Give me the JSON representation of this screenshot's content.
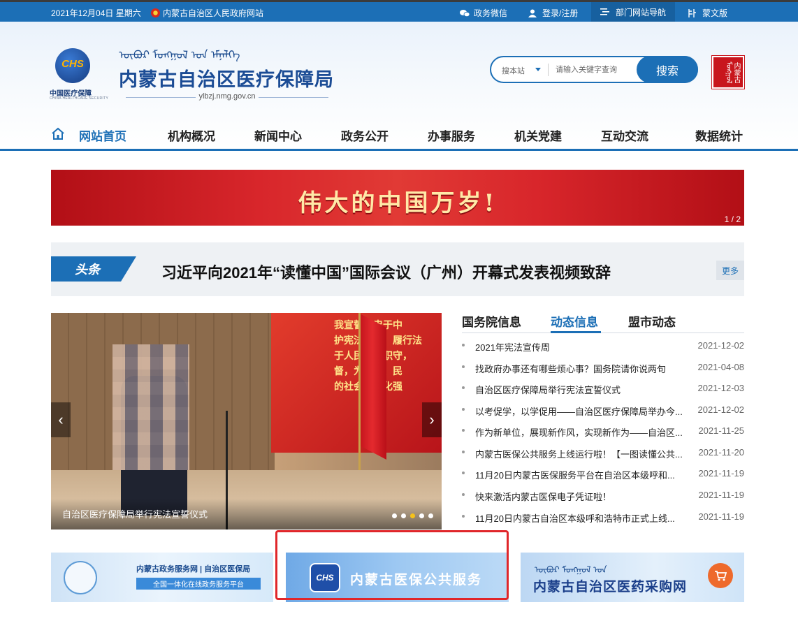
{
  "topbar": {
    "date": "2021年12月04日 星期六",
    "gov_link": "内蒙古自治区人民政府网站",
    "wechat": "政务微信",
    "login": "登录/注册",
    "dept_nav": "部门网站导航",
    "mongolian": "蒙文版"
  },
  "header": {
    "logo_text": "CHS",
    "logo_cn": "中国医疗保障",
    "logo_en": "CHINA HEALTHCARE SECURITY",
    "mongolian_title": "ᠥᠪᠦᠷ ᠮᠣᠩᠭᠣᠯ ᠤᠨ ᠡᠮᠨᠡᠯᠭᠡ",
    "title": "内蒙古自治区医疗保障局",
    "domain": "ylbzj.nmg.gov.cn",
    "seal_text": "内蒙古ᠮᠣᠩᠭᠣᠯ"
  },
  "search": {
    "scope": "搜本站",
    "placeholder": "请输入关键字查询",
    "button": "搜索"
  },
  "nav": {
    "items": [
      "网站首页",
      "机构概况",
      "新闻中心",
      "政务公开",
      "办事服务",
      "机关党建",
      "互动交流",
      "数据统计"
    ]
  },
  "banner": {
    "text": "伟大的中国万岁!",
    "page": "1 / 2"
  },
  "headline": {
    "tag": "头条",
    "title": "习近平向2021年“读懂中国”国际会议（广州）开幕式发表视频致辞",
    "more": "更多"
  },
  "carousel": {
    "caption": "自治区医疗保障局举行宪法宣誓仪式",
    "oath_lines": [
      "我宣誓：忠于中",
      "护宪法权威，履行法",
      "于人民，尽职守，",
      "督，为富强、民",
      "的社会现代化强"
    ],
    "prev": "‹",
    "next": "›",
    "active_dot": 3
  },
  "news": {
    "tabs": [
      "国务院信息",
      "动态信息",
      "盟市动态"
    ],
    "active_tab": 1,
    "items": [
      {
        "title": "2021年宪法宣传周",
        "date": "2021-12-02"
      },
      {
        "title": "找政府办事还有哪些烦心事？国务院请你说两句",
        "date": "2021-04-08"
      },
      {
        "title": "自治区医疗保障局举行宪法宣誓仪式",
        "date": "2021-12-03"
      },
      {
        "title": "以考促学，以学促用——自治区医疗保障局举办今...",
        "date": "2021-12-02"
      },
      {
        "title": "作为新单位，展现新作风，实现新作为——自治区...",
        "date": "2021-11-25"
      },
      {
        "title": "内蒙古医保公共服务上线运行啦！【一图读懂公共...",
        "date": "2021-11-20"
      },
      {
        "title": "11月20日内蒙古医保服务平台在自治区本级呼和...",
        "date": "2021-11-19"
      },
      {
        "title": "快来激活内蒙古医保电子凭证啦！",
        "date": "2021-11-19"
      },
      {
        "title": "11月20日内蒙古自治区本级呼和浩特市正式上线...",
        "date": "2021-11-19"
      }
    ]
  },
  "services": {
    "svc1_title": "内蒙古政务服务网 | 自治区医保局",
    "svc1_sub": "全国一体化在线政务服务平台",
    "svc2_icon": "CHS",
    "svc2_title": "内蒙古医保公共服务",
    "svc3_mongolian": "ᠥᠪᠦᠷ ᠮᠣᠩᠭᠣᠯ ᠤᠨ",
    "svc3_title": "内蒙古自治区医药采购网"
  },
  "colors": {
    "primary": "#1c6fb6",
    "banner_red": "#d8262b",
    "highlight": "#e0262a",
    "accent_gold": "#f5c21a"
  },
  "icons": [
    "emblem-icon",
    "wechat-icon",
    "user-icon",
    "menu-icon",
    "mongol-icon",
    "home-icon",
    "cart-icon"
  ]
}
